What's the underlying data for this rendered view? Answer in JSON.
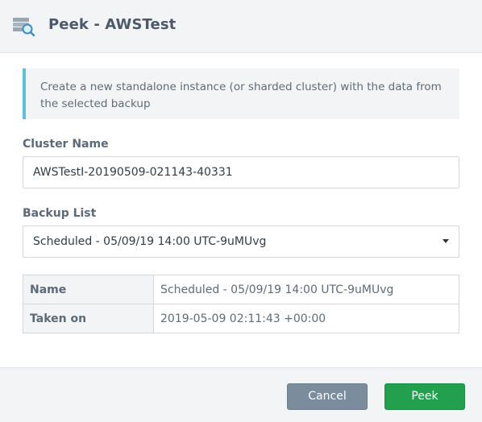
{
  "header": {
    "icon": "database-search-icon",
    "title": "Peek - AWSTest"
  },
  "info": {
    "text": "Create a new standalone instance (or sharded cluster) with the data from the selected backup",
    "accent_color": "#5bc0de"
  },
  "cluster_name": {
    "label": "Cluster Name",
    "value": "AWSTestI-20190509-021143-40331"
  },
  "backup_list": {
    "label": "Backup List",
    "selected": "Scheduled - 05/09/19 14:00 UTC-9uMUvg",
    "icon": "caret-down-icon"
  },
  "details": {
    "rows": [
      {
        "key": "Name",
        "value": "Scheduled - 05/09/19 14:00 UTC-9uMUvg"
      },
      {
        "key": "Taken on",
        "value": "2019-05-09 02:11:43 +00:00"
      }
    ]
  },
  "footer": {
    "cancel_label": "Cancel",
    "peek_label": "Peek",
    "cancel_color": "#7b8c9c",
    "peek_color": "#23a04d"
  }
}
